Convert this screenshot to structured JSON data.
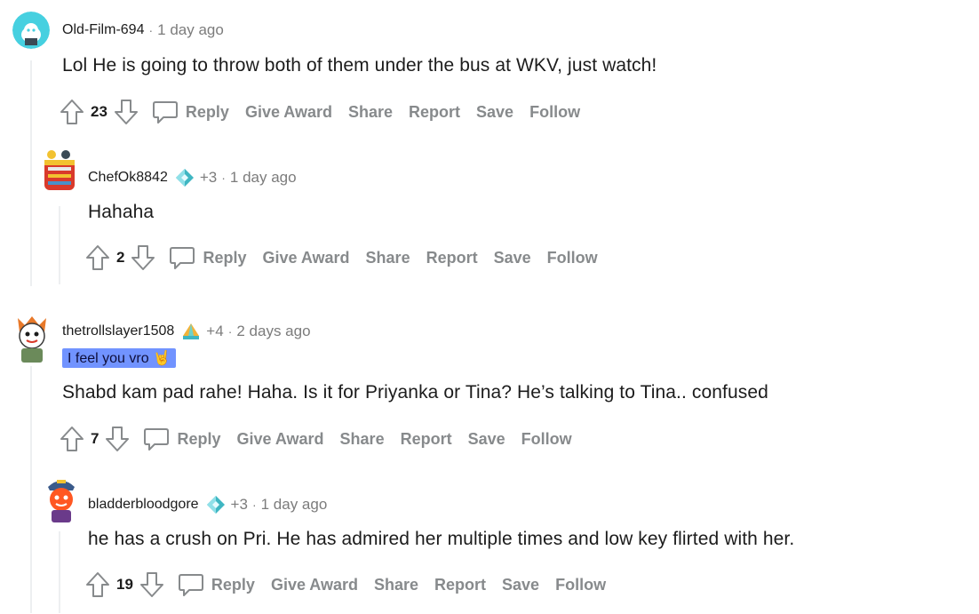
{
  "comments": [
    {
      "username": "Old-Film-694",
      "plus": "",
      "time": "1 day ago",
      "flair": "",
      "body": "Lol He is going to throw both of them under the bus at WKV, just watch!",
      "score": "23"
    },
    {
      "username": "ChefOk8842",
      "plus": "+3",
      "time": "1 day ago",
      "flair": "",
      "body": "Hahaha",
      "score": "2"
    },
    {
      "username": "thetrollslayer1508",
      "plus": "+4",
      "time": "2 days ago",
      "flair": "I feel you vro 🤘",
      "body": "Shabd kam pad rahe! Haha. Is it for Priyanka or Tina? He’s talking to Tina.. confused",
      "score": "7"
    },
    {
      "username": "bladderbloodgore",
      "plus": "+3",
      "time": "1 day ago",
      "flair": "",
      "body": "he has a crush on Pri. He has admired her multiple times and low key flirted with her.",
      "score": "19"
    }
  ],
  "actions": {
    "reply": "Reply",
    "give_award": "Give Award",
    "share": "Share",
    "report": "Report",
    "save": "Save",
    "follow": "Follow"
  },
  "separator": "·",
  "colors": {
    "meta_gray": "#7c7c7c",
    "action_gray": "#878a8c",
    "flair_bg": "#7193ff",
    "thread_line": "#edeff1"
  },
  "icons": [
    "upvote-icon",
    "downvote-icon",
    "comment-bubble-icon",
    "award-icon",
    "avatar-icon"
  ]
}
